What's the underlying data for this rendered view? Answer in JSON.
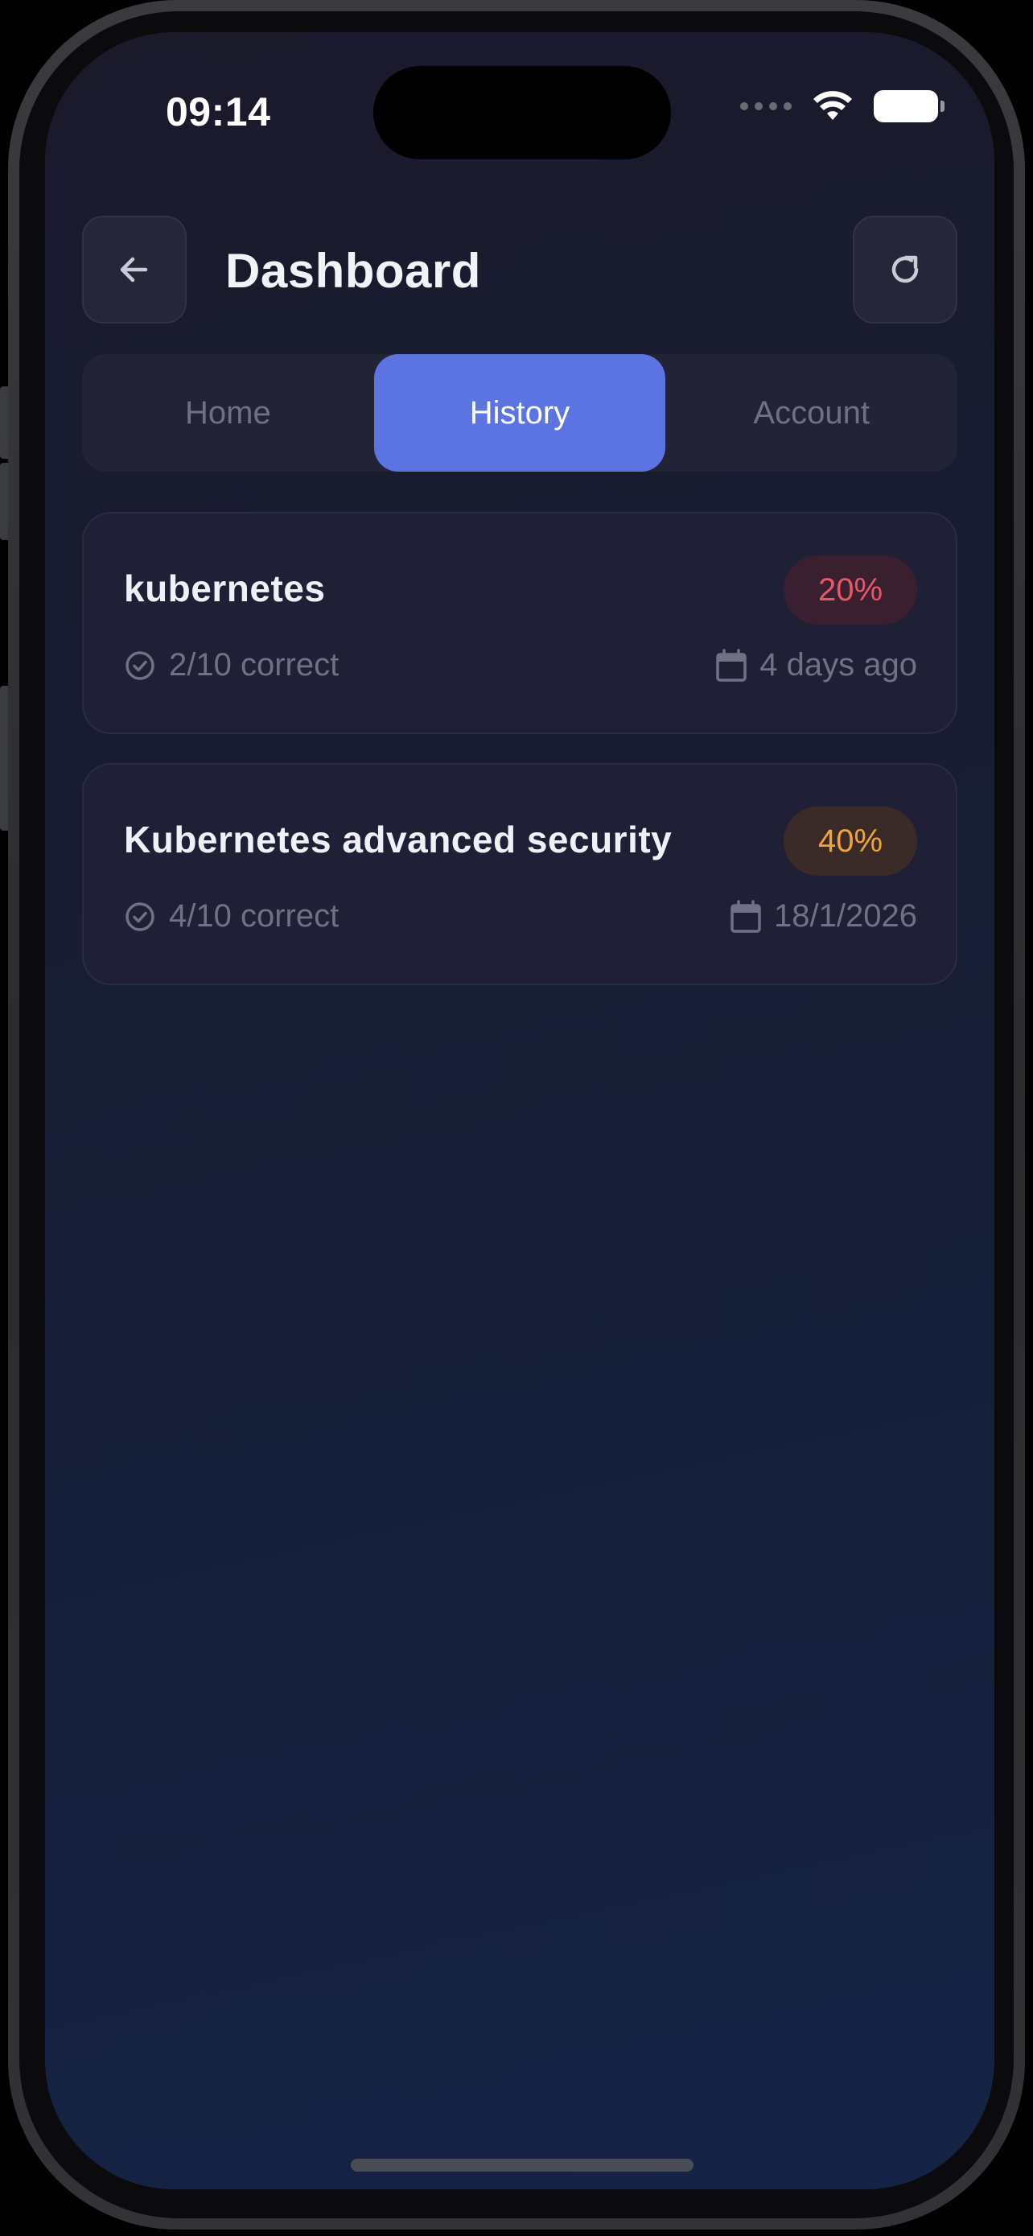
{
  "status_bar": {
    "time": "09:14"
  },
  "header": {
    "title": "Dashboard",
    "back_icon": "arrow-left-icon",
    "refresh_icon": "refresh-icon"
  },
  "tabs": [
    {
      "label": "Home",
      "active": false
    },
    {
      "label": "History",
      "active": true
    },
    {
      "label": "Account",
      "active": false
    }
  ],
  "history": [
    {
      "title": "kubernetes",
      "score": "20%",
      "score_color": "#e9566a",
      "correct": "2/10 correct",
      "date": "4 days ago"
    },
    {
      "title": "Kubernetes advanced security",
      "score": "40%",
      "score_color": "#f2a23a",
      "correct": "4/10 correct",
      "date": "18/1/2026"
    }
  ],
  "colors": {
    "accent": "#5b74e1",
    "background": "#171d33"
  }
}
